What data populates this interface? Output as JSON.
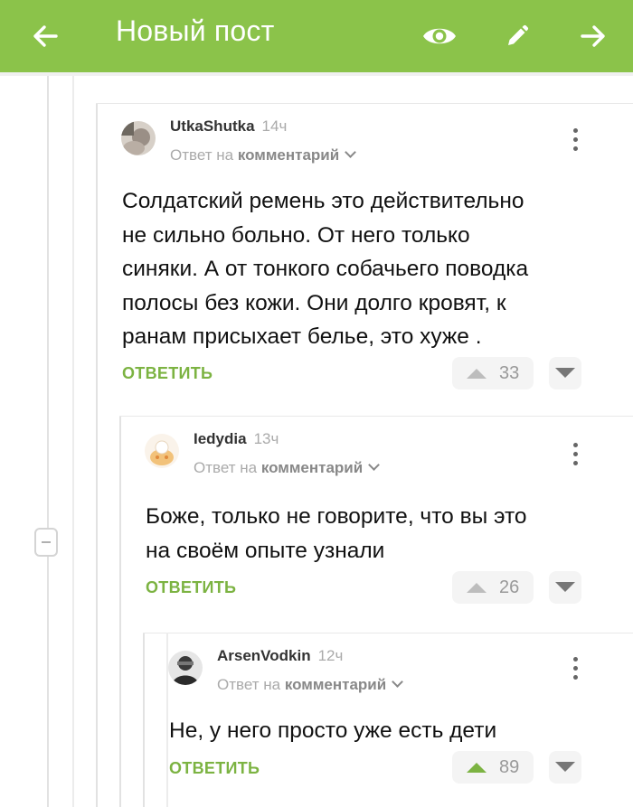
{
  "colors": {
    "accent": "#8bc34a"
  },
  "header": {
    "title": "Новый пост",
    "back_icon": "arrow-left-icon",
    "preview_icon": "eye-icon",
    "edit_icon": "pencil-icon",
    "forward_icon": "arrow-right-icon"
  },
  "comments": [
    {
      "author": "UtkaShutka",
      "time": "14ч",
      "reply_prefix": "Ответ на",
      "reply_target": "комментарий",
      "text": [
        "Солдатский ремень это действительно",
        "не сильно больно. От него только",
        "синяки. А от тонкого собачьего поводка",
        "полосы без кожи. Они долго кровят, к",
        "ранам присыхает белье, это хуже ."
      ],
      "answer_label": "ОТВЕТИТЬ",
      "rating": "33"
    },
    {
      "author": "Iedydia",
      "time": "13ч",
      "reply_prefix": "Ответ на",
      "reply_target": "комментарий",
      "text": [
        "Боже, только не говорите, что вы это",
        "на своём опыте узнали"
      ],
      "answer_label": "ОТВЕТИТЬ",
      "rating": "26"
    },
    {
      "author": "ArsenVodkin",
      "time": "12ч",
      "reply_prefix": "Ответ на",
      "reply_target": "комментарий",
      "text": [
        "Не, у него просто уже есть дети"
      ],
      "answer_label": "ОТВЕТИТЬ",
      "rating": "89"
    }
  ]
}
